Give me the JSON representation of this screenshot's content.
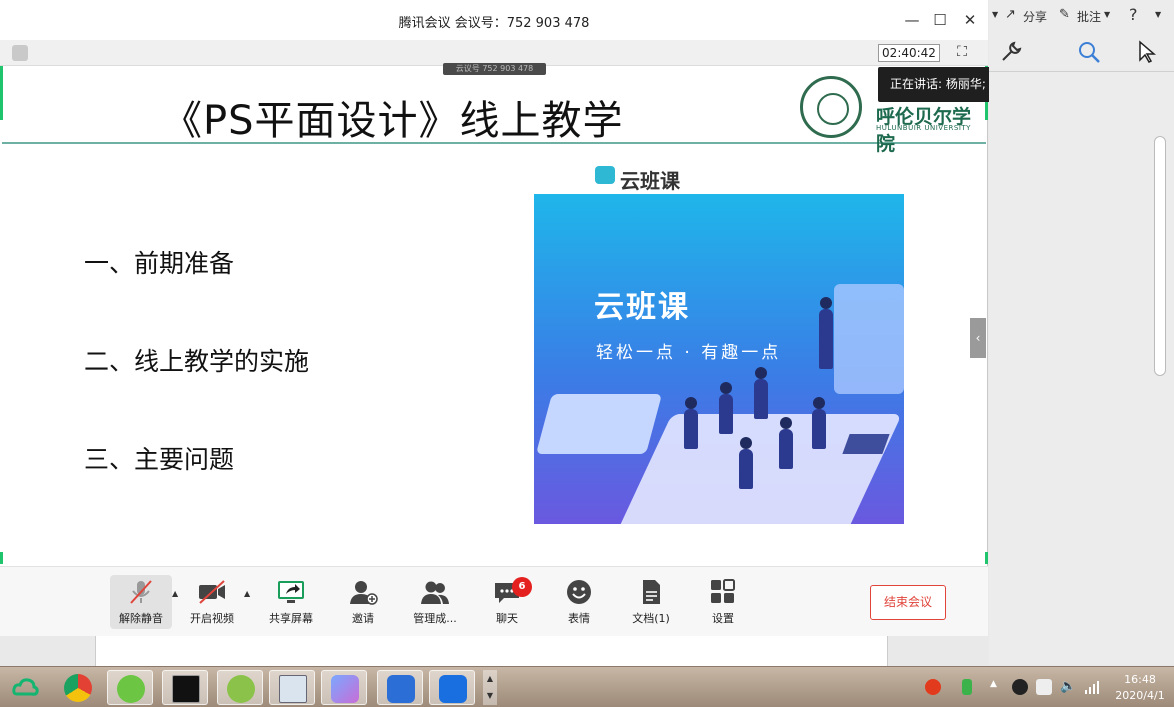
{
  "window": {
    "title": "腾讯会议 会议号：752 903 478",
    "timer": "02:40:42",
    "meeting_badge": "云议号 752 903 478",
    "speaker_label": "正在讲话: 杨丽华;"
  },
  "slide": {
    "title": "《PS平面设计》线上教学",
    "logo_cn": "呼伦贝尔学院",
    "logo_en": "HULUNBUIR UNIVERSITY",
    "items": [
      "一、前期准备",
      "二、线上教学的实施",
      "三、主要问题"
    ],
    "yunbanke_label": "云班课",
    "banner_title": "云班课",
    "banner_slogan": "轻松一点 · 有趣一点"
  },
  "toolbar": {
    "unmute": "解除静音",
    "video": "开启视频",
    "share": "共享屏幕",
    "invite": "邀请",
    "manage": "管理成...",
    "chat": "聊天",
    "chat_badge": "6",
    "emoji": "表情",
    "docs": "文档(1)",
    "settings": "设置",
    "end": "结束会议"
  },
  "reader": {
    "share": "分享",
    "annotate": "批注",
    "help": "?"
  },
  "taskbar": {
    "time": "16:48",
    "date": "2020/4/1"
  },
  "colors": {
    "accent_red": "#e0443b",
    "banner_blue": "#1fb6ea",
    "speaker_bg": "#1f1f1f"
  }
}
